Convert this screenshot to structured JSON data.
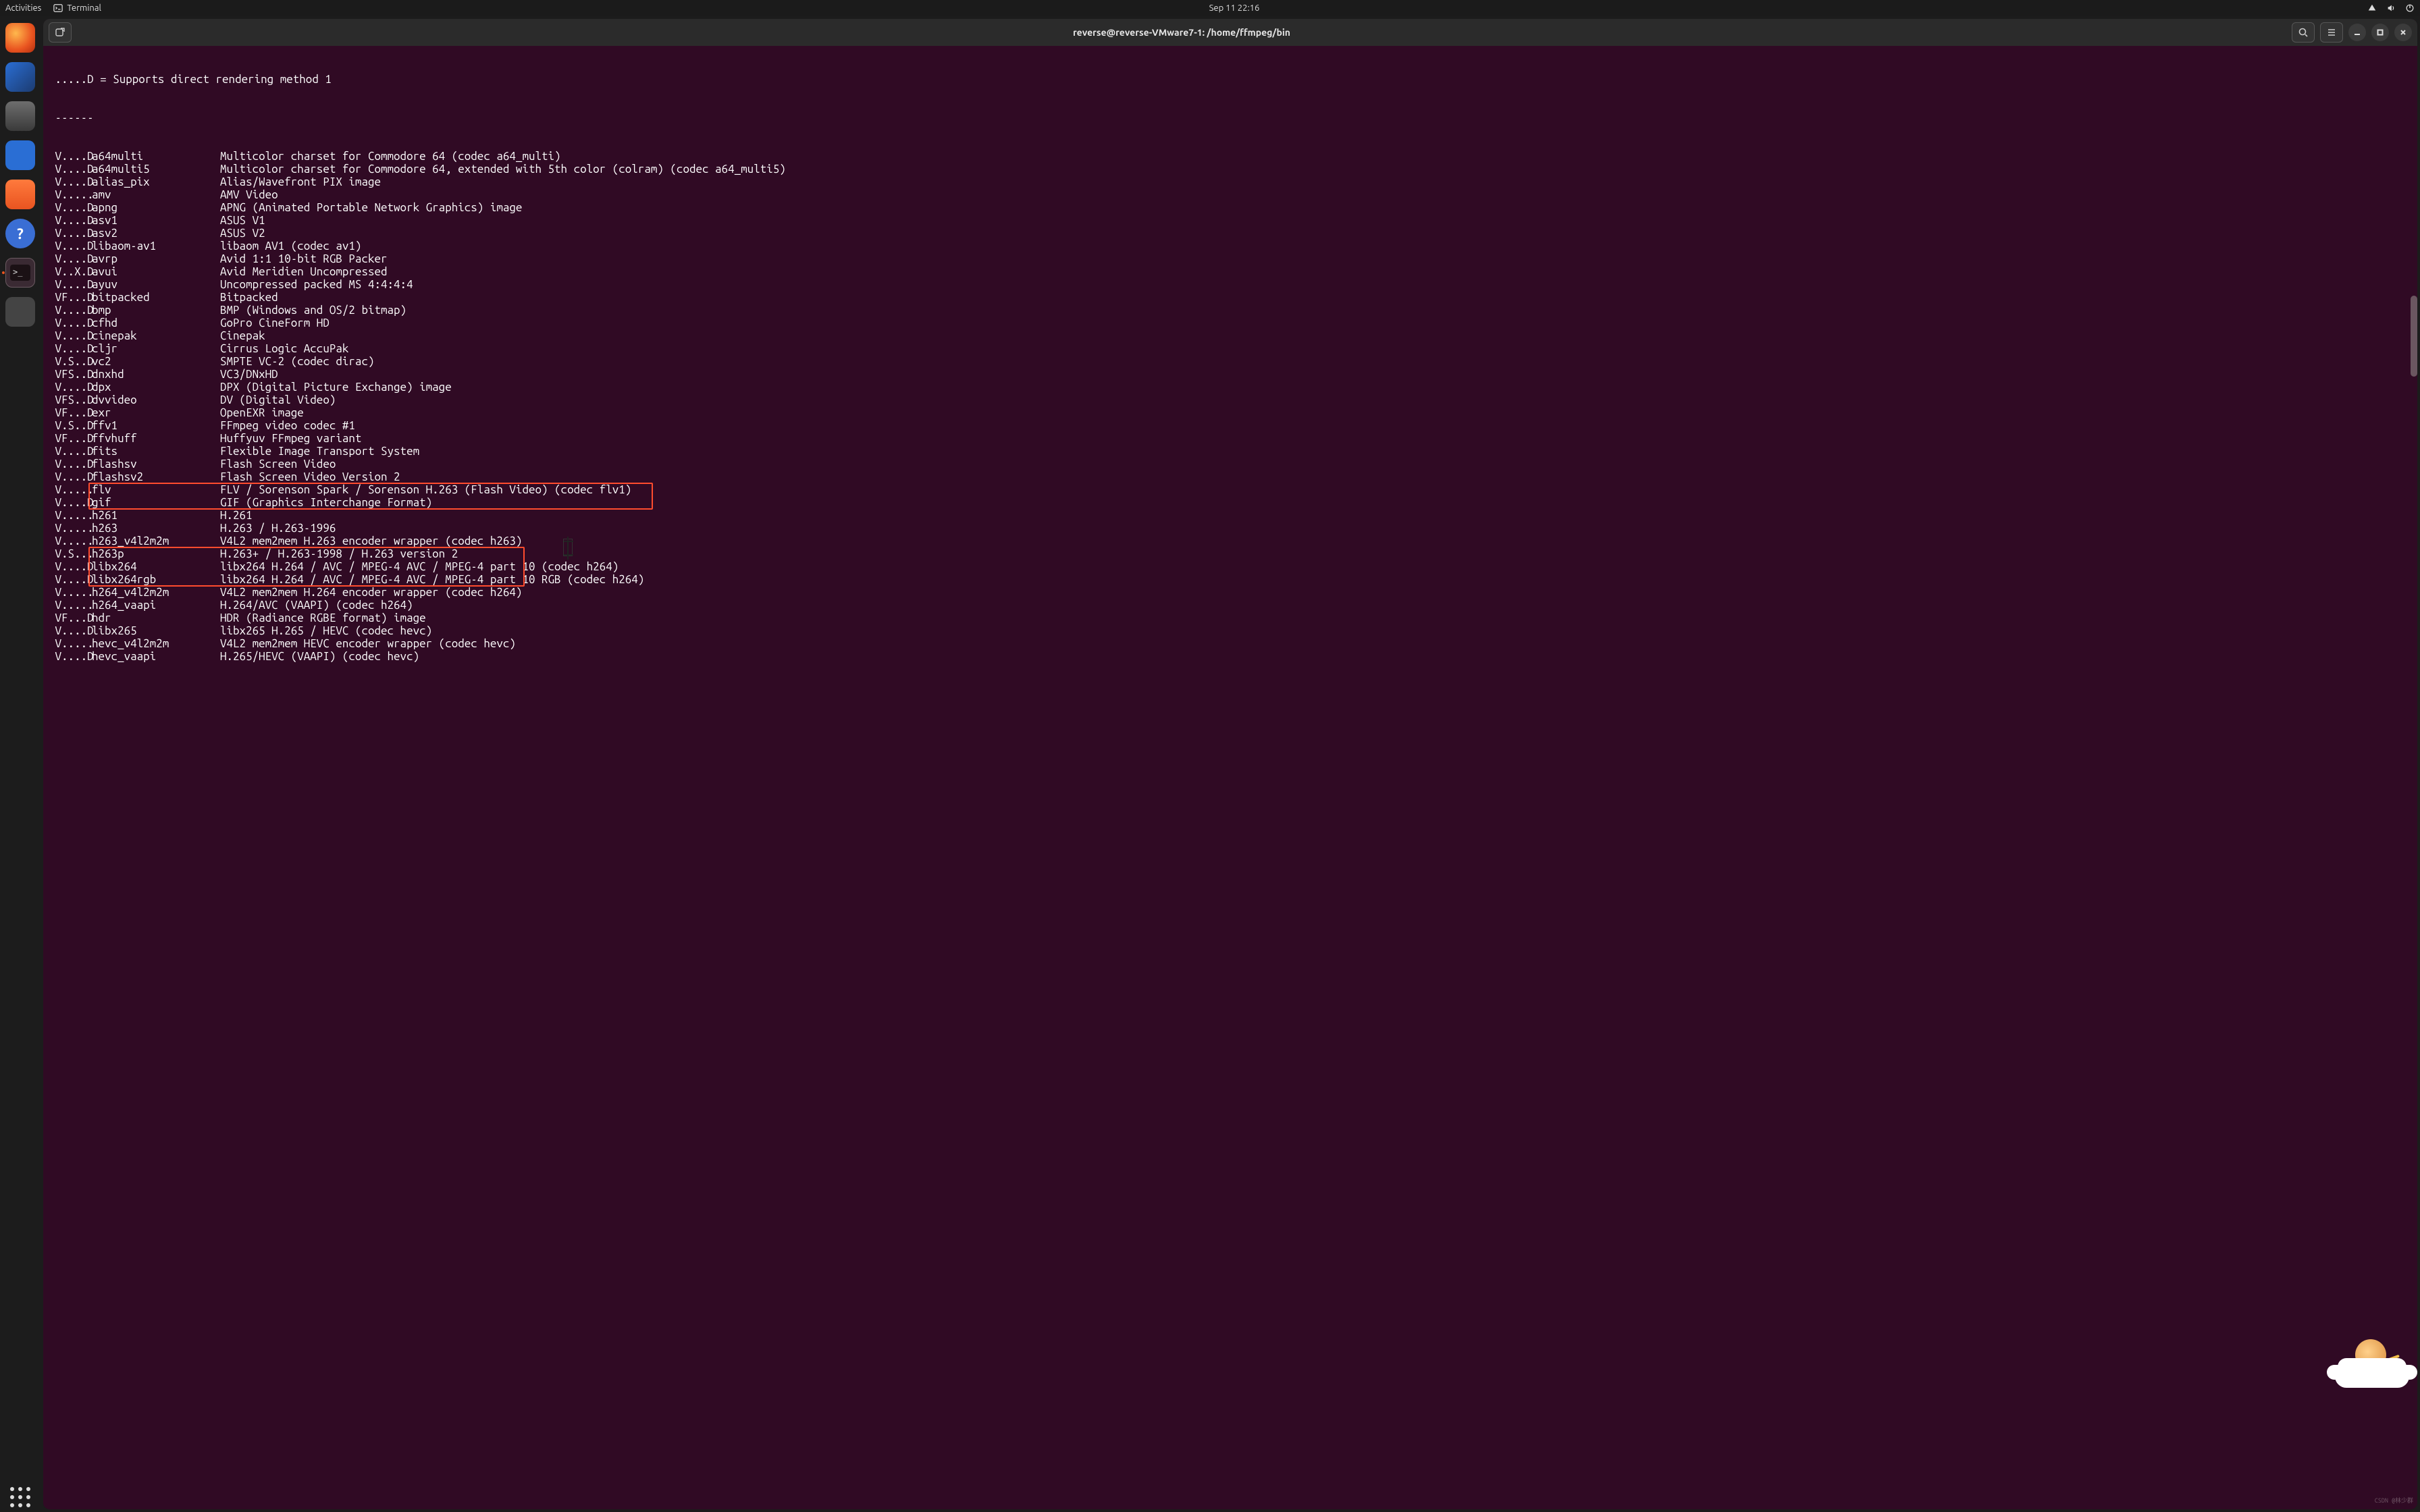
{
  "topbar": {
    "activities": "Activities",
    "terminal_label": "Terminal",
    "clock": "Sep 11  22:16"
  },
  "window": {
    "title": "reverse@reverse-VMware7-1: /home/ffmpeg/bin"
  },
  "terminal": {
    "header_line": " .....D = Supports direct rendering method 1",
    "divider": " ------",
    "rows": [
      {
        "flags": " V....D",
        "name": "a64multi",
        "desc": "Multicolor charset for Commodore 64 (codec a64_multi)"
      },
      {
        "flags": " V....D",
        "name": "a64multi5",
        "desc": "Multicolor charset for Commodore 64, extended with 5th color (colram) (codec a64_multi5)"
      },
      {
        "flags": " V....D",
        "name": "alias_pix",
        "desc": "Alias/Wavefront PIX image"
      },
      {
        "flags": " V.....",
        "name": "amv",
        "desc": "AMV Video"
      },
      {
        "flags": " V....D",
        "name": "apng",
        "desc": "APNG (Animated Portable Network Graphics) image"
      },
      {
        "flags": " V....D",
        "name": "asv1",
        "desc": "ASUS V1"
      },
      {
        "flags": " V....D",
        "name": "asv2",
        "desc": "ASUS V2"
      },
      {
        "flags": " V....D",
        "name": "libaom-av1",
        "desc": "libaom AV1 (codec av1)"
      },
      {
        "flags": " V....D",
        "name": "avrp",
        "desc": "Avid 1:1 10-bit RGB Packer"
      },
      {
        "flags": " V..X.D",
        "name": "avui",
        "desc": "Avid Meridien Uncompressed"
      },
      {
        "flags": " V....D",
        "name": "ayuv",
        "desc": "Uncompressed packed MS 4:4:4:4"
      },
      {
        "flags": " VF...D",
        "name": "bitpacked",
        "desc": "Bitpacked"
      },
      {
        "flags": " V....D",
        "name": "bmp",
        "desc": "BMP (Windows and OS/2 bitmap)"
      },
      {
        "flags": " V....D",
        "name": "cfhd",
        "desc": "GoPro CineForm HD"
      },
      {
        "flags": " V....D",
        "name": "cinepak",
        "desc": "Cinepak"
      },
      {
        "flags": " V....D",
        "name": "cljr",
        "desc": "Cirrus Logic AccuPak"
      },
      {
        "flags": " V.S..D",
        "name": "vc2",
        "desc": "SMPTE VC-2 (codec dirac)"
      },
      {
        "flags": " VFS..D",
        "name": "dnxhd",
        "desc": "VC3/DNxHD"
      },
      {
        "flags": " V....D",
        "name": "dpx",
        "desc": "DPX (Digital Picture Exchange) image"
      },
      {
        "flags": " VFS..D",
        "name": "dvvideo",
        "desc": "DV (Digital Video)"
      },
      {
        "flags": " VF...D",
        "name": "exr",
        "desc": "OpenEXR image"
      },
      {
        "flags": " V.S..D",
        "name": "ffv1",
        "desc": "FFmpeg video codec #1"
      },
      {
        "flags": " VF...D",
        "name": "ffvhuff",
        "desc": "Huffyuv FFmpeg variant"
      },
      {
        "flags": " V....D",
        "name": "fits",
        "desc": "Flexible Image Transport System"
      },
      {
        "flags": " V....D",
        "name": "flashsv",
        "desc": "Flash Screen Video"
      },
      {
        "flags": " V....D",
        "name": "flashsv2",
        "desc": "Flash Screen Video Version 2"
      },
      {
        "flags": " V.....",
        "name": "flv",
        "desc": "FLV / Sorenson Spark / Sorenson H.263 (Flash Video) (codec flv1)"
      },
      {
        "flags": " V....D",
        "name": "gif",
        "desc": "GIF (Graphics Interchange Format)"
      },
      {
        "flags": " V.....",
        "name": "h261",
        "desc": "H.261"
      },
      {
        "flags": " V.....",
        "name": "h263",
        "desc": "H.263 / H.263-1996"
      },
      {
        "flags": " V.....",
        "name": "h263_v4l2m2m",
        "desc": "V4L2 mem2mem H.263 encoder wrapper (codec h263)"
      },
      {
        "flags": " V.S...",
        "name": "h263p",
        "desc": "H.263+ / H.263-1998 / H.263 version 2"
      },
      {
        "flags": " V....D",
        "name": "libx264",
        "desc": "libx264 H.264 / AVC / MPEG-4 AVC / MPEG-4 part 10 (codec h264)"
      },
      {
        "flags": " V....D",
        "name": "libx264rgb",
        "desc": "libx264 H.264 / AVC / MPEG-4 AVC / MPEG-4 part 10 RGB (codec h264)"
      },
      {
        "flags": " V.....",
        "name": "h264_v4l2m2m",
        "desc": "V4L2 mem2mem H.264 encoder wrapper (codec h264)"
      },
      {
        "flags": " V.....",
        "name": "h264_vaapi",
        "desc": "H.264/AVC (VAAPI) (codec h264)"
      },
      {
        "flags": " VF...D",
        "name": "hdr",
        "desc": "HDR (Radiance RGBE format) image"
      },
      {
        "flags": " V....D",
        "name": "libx265",
        "desc": "libx265 H.265 / HEVC (codec hevc)"
      },
      {
        "flags": " V.....",
        "name": "hevc_v4l2m2m",
        "desc": "V4L2 mem2mem HEVC encoder wrapper (codec hevc)"
      },
      {
        "flags": " V....D",
        "name": "hevc_vaapi",
        "desc": "H.265/HEVC (VAAPI) (codec hevc)"
      }
    ]
  },
  "highlights": [
    {
      "topRow": 32,
      "rows": 2,
      "widthCh": 88
    },
    {
      "topRow": 37,
      "rows": 3,
      "widthCh": 68
    }
  ],
  "watermark": "CSDN @林少群"
}
